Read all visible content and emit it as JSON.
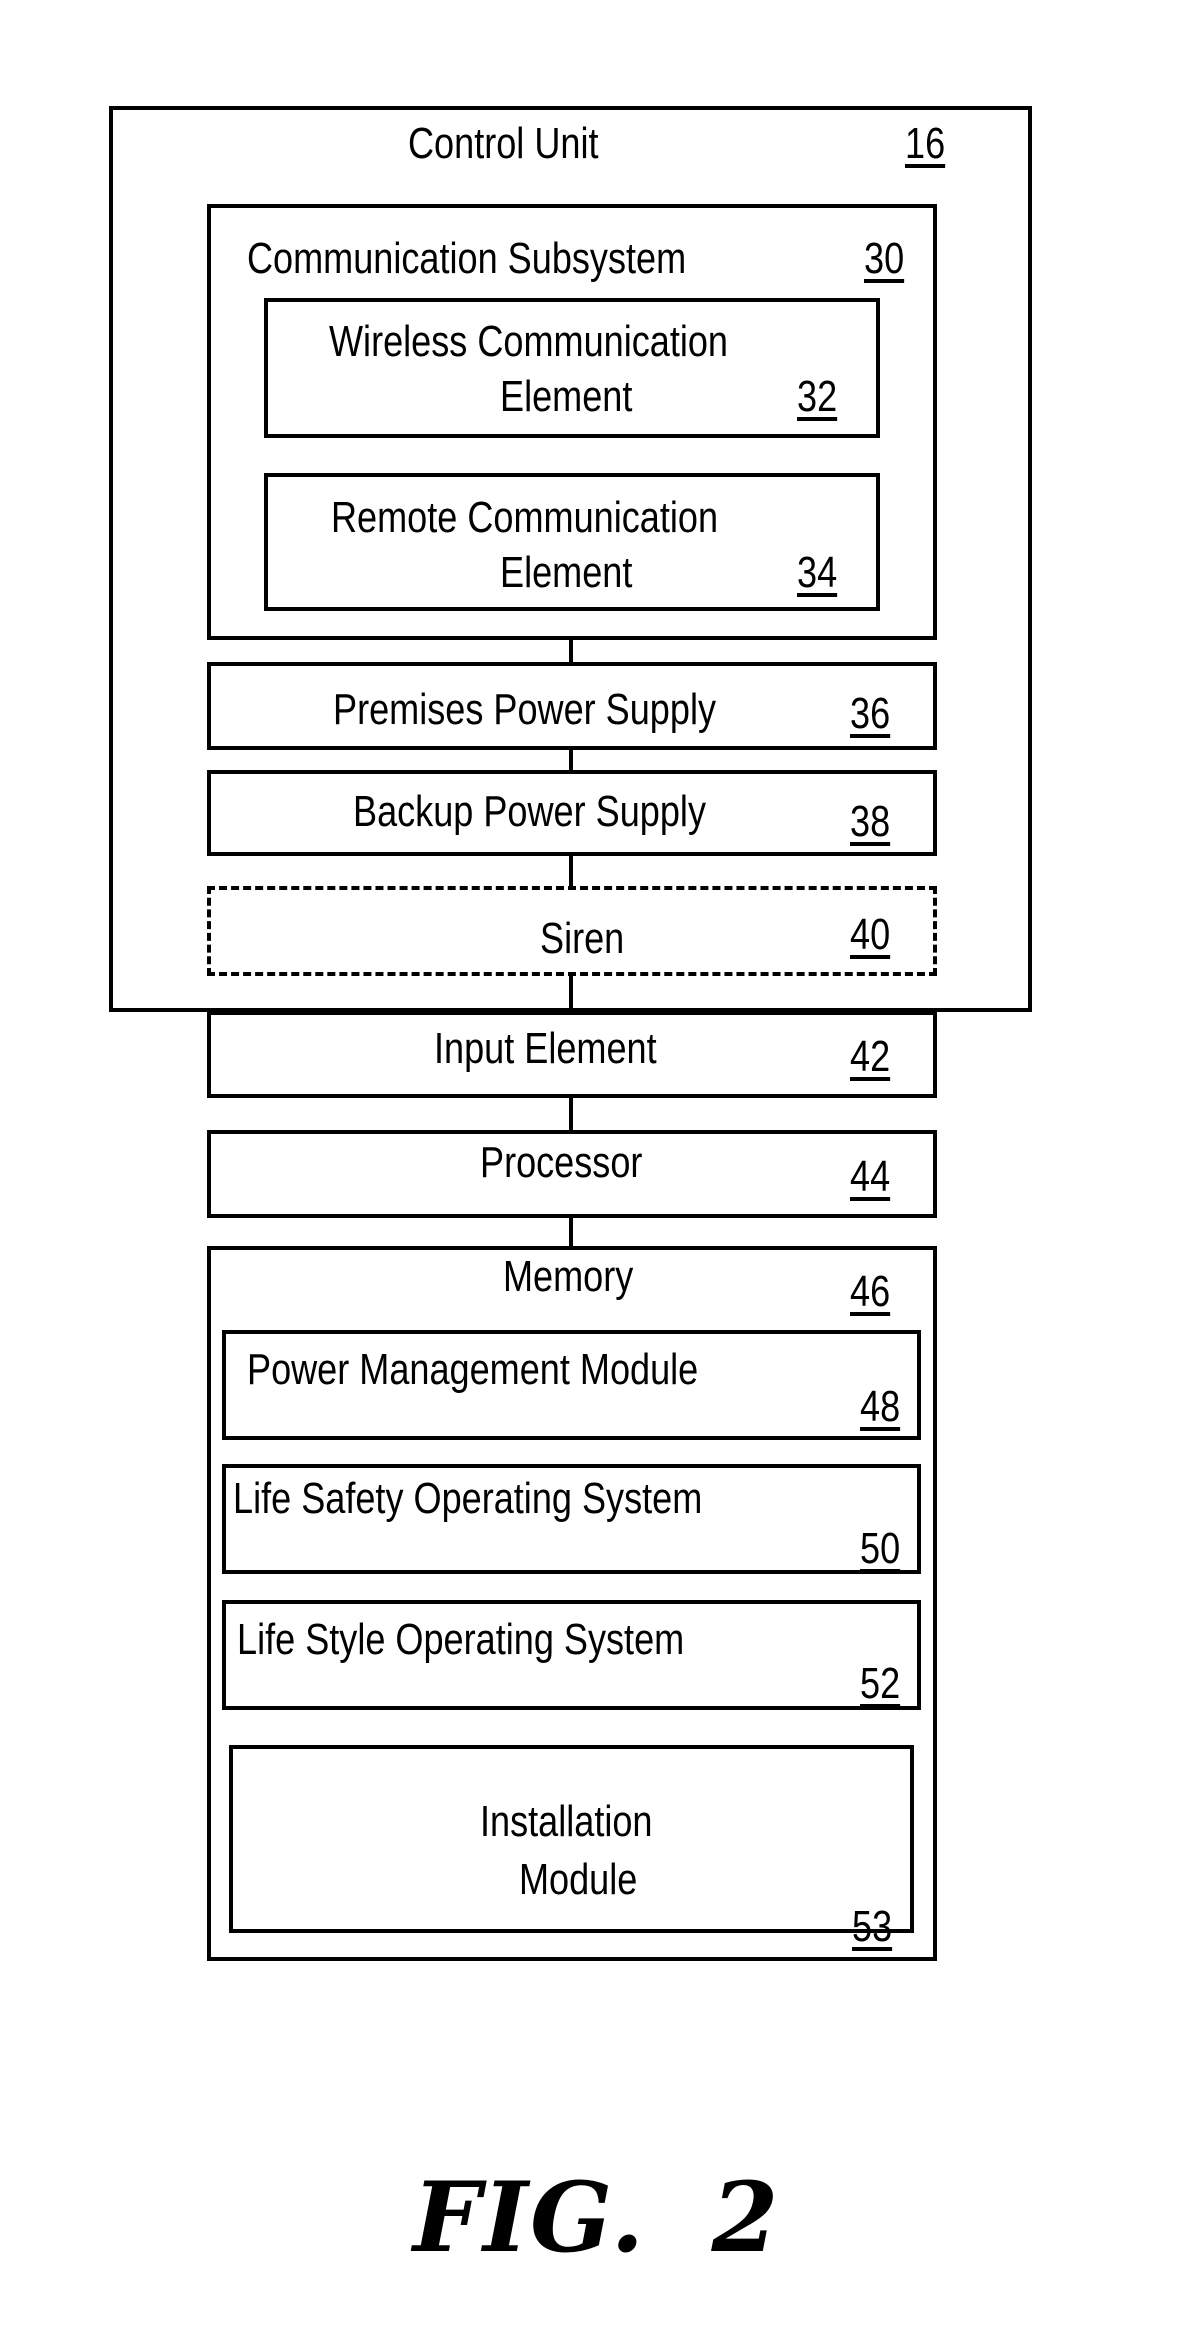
{
  "control_unit": {
    "label": "Control Unit",
    "ref": "16"
  },
  "communication_subsystem": {
    "label": "Communication Subsystem",
    "ref": "30",
    "wireless": {
      "line1": "Wireless Communication",
      "line2": "Element",
      "ref": "32"
    },
    "remote": {
      "line1": "Remote Communication",
      "line2": "Element",
      "ref": "34"
    }
  },
  "premises_power": {
    "label": "Premises Power Supply",
    "ref": "36"
  },
  "backup_power": {
    "label": "Backup Power Supply",
    "ref": "38"
  },
  "siren": {
    "label": "Siren",
    "ref": "40",
    "optional": true
  },
  "input_element": {
    "label": "Input Element",
    "ref": "42"
  },
  "processor": {
    "label": "Processor",
    "ref": "44"
  },
  "memory": {
    "label": "Memory",
    "ref": "46",
    "modules": [
      {
        "label": "Power Management Module",
        "ref": "48"
      },
      {
        "label": "Life Safety Operating System",
        "ref": "50"
      },
      {
        "label": "Life Style Operating System",
        "ref": "52"
      },
      {
        "line1": "Installation",
        "line2": "Module",
        "ref": "53"
      }
    ]
  },
  "figure_caption": "FIG. 2"
}
